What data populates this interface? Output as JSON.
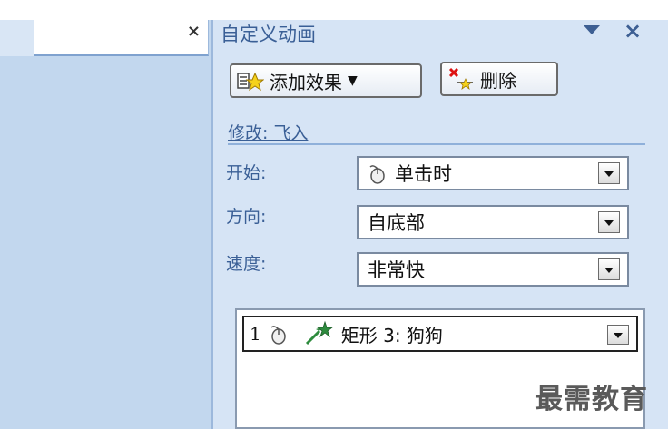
{
  "left_tab": {
    "close": "×"
  },
  "pane": {
    "title": "自定义动画",
    "close": "×",
    "add_effect_label": "添加效果",
    "delete_label": "删除",
    "modify_label": "修改: 飞入"
  },
  "fields": {
    "start": {
      "label": "开始:",
      "value": "单击时"
    },
    "direction": {
      "label": "方向:",
      "value": "自底部"
    },
    "speed": {
      "label": "速度:",
      "value": "非常快"
    }
  },
  "animation_list": [
    {
      "number": "1",
      "name": "矩形 3: 狗狗"
    }
  ],
  "watermark": "最需教育",
  "colors": {
    "pane_bg": "#d6e4f5",
    "left_panel": "#c2d7ee",
    "label_blue": "#3a5f96"
  }
}
